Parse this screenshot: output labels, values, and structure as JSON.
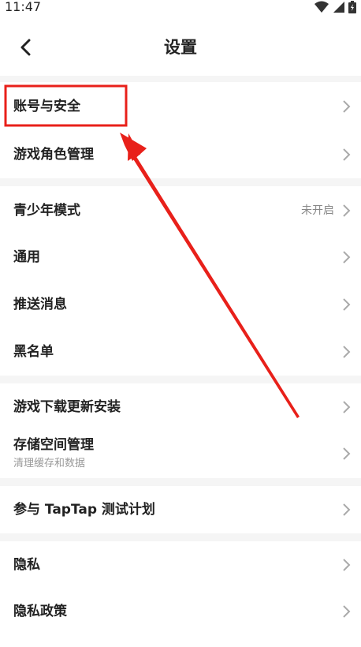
{
  "status_bar": {
    "time": "11:47"
  },
  "header": {
    "title": "设置"
  },
  "groups": [
    {
      "items": [
        {
          "label": "账号与安全"
        },
        {
          "label": "游戏角色管理"
        }
      ]
    },
    {
      "items": [
        {
          "label": "青少年模式",
          "value": "未开启"
        },
        {
          "label": "通用"
        },
        {
          "label": "推送消息"
        },
        {
          "label": "黑名单"
        }
      ]
    },
    {
      "items": [
        {
          "label": "游戏下载更新安装"
        },
        {
          "label": "存储空间管理",
          "sub": "清理缓存和数据"
        }
      ]
    },
    {
      "items": [
        {
          "label": "参与 TapTap 测试计划"
        }
      ]
    },
    {
      "items": [
        {
          "label": "隐私"
        },
        {
          "label": "隐私政策"
        }
      ]
    }
  ],
  "annotation": {
    "highlight_color": "#e8201a",
    "arrow_color": "#e8201a"
  }
}
